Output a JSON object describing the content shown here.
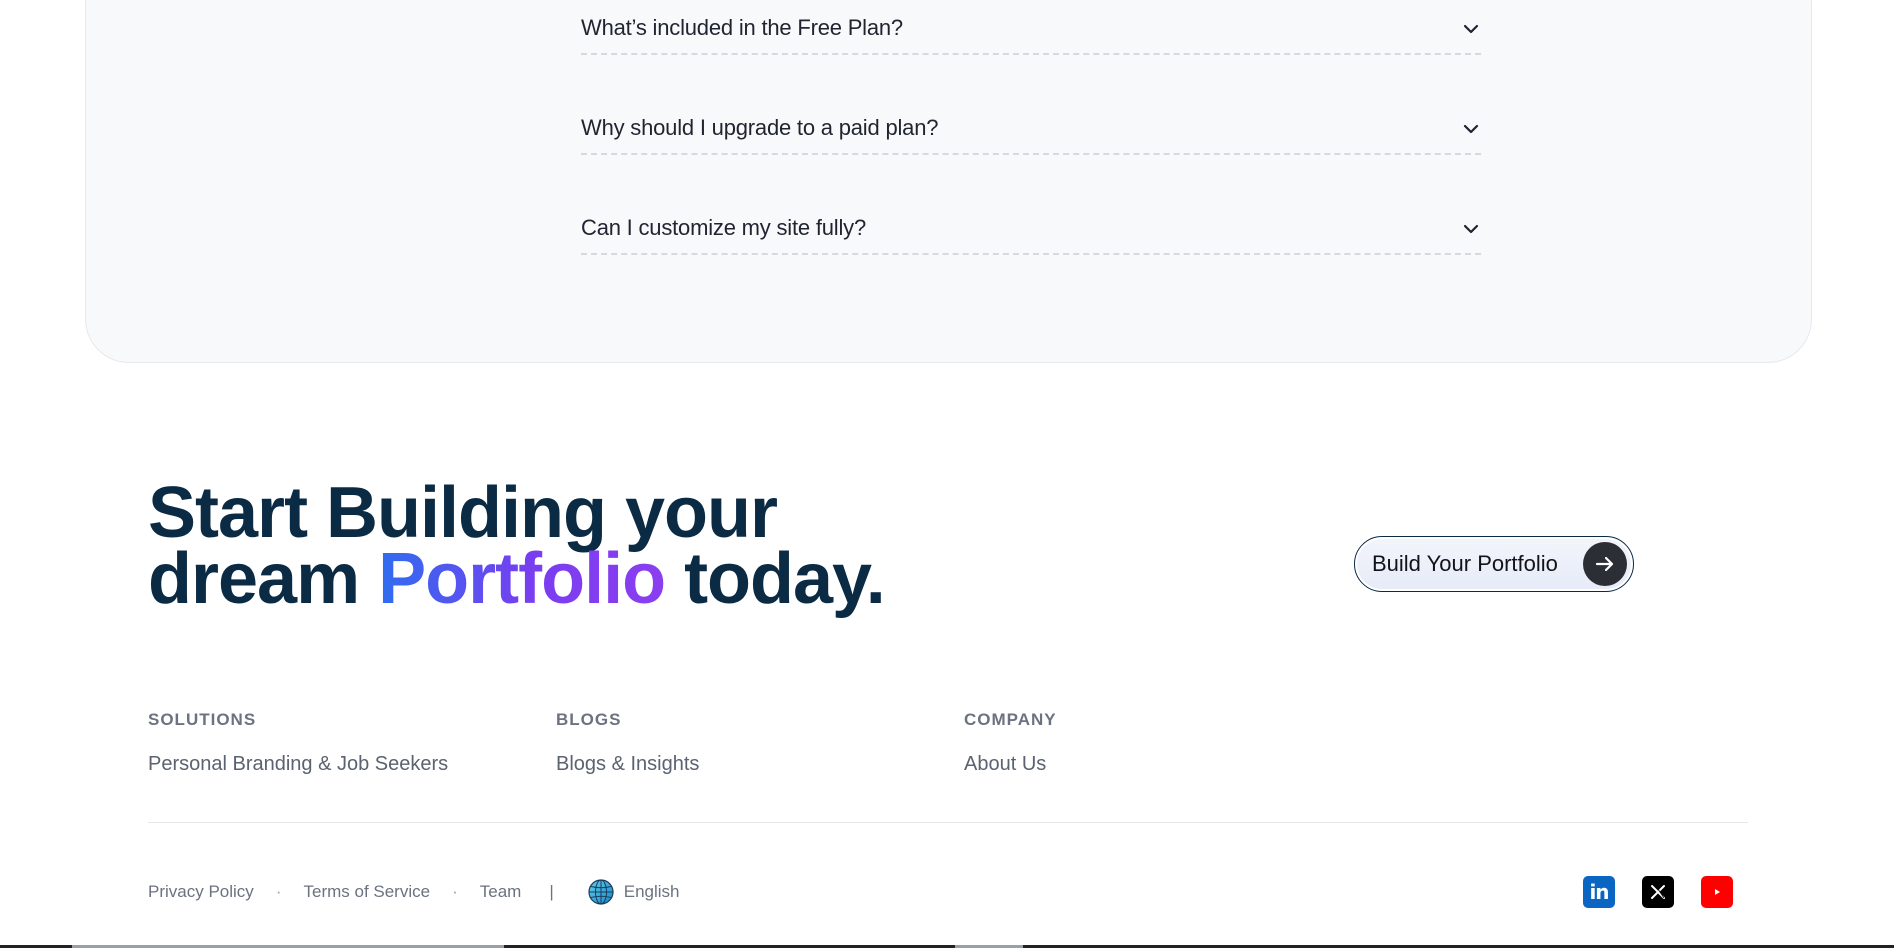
{
  "faq": {
    "items": [
      {
        "question": "What’s included in the Free Plan?"
      },
      {
        "question": "Why should I upgrade to a paid plan?"
      },
      {
        "question": "Can I customize my site fully?"
      }
    ]
  },
  "cta": {
    "line1": "Start Building your",
    "line2_start": "dream ",
    "line2_highlight": "Portfolio",
    "line2_end": " today.",
    "button_label": "Build Your Portfolio"
  },
  "footer": {
    "columns": [
      {
        "heading": "SOLUTIONS",
        "link": "Personal Branding & Job Seekers"
      },
      {
        "heading": "BLOGS",
        "link": "Blogs & Insights"
      },
      {
        "heading": "COMPANY",
        "link": "About Us"
      }
    ],
    "bottom": {
      "privacy": "Privacy Policy",
      "terms": "Terms of Service",
      "team": "Team",
      "separator": "·",
      "pipe": "|",
      "language": "English"
    },
    "social": {
      "linkedin": "in",
      "x_icon": "x-icon",
      "youtube_icon": "youtube-icon"
    }
  },
  "colors": {
    "brand_dark": "#0b2a44",
    "gradient_start": "#2f6df0",
    "gradient_end": "#8a3ff0",
    "linkedin": "#0a66c2",
    "youtube": "#ff0000"
  }
}
